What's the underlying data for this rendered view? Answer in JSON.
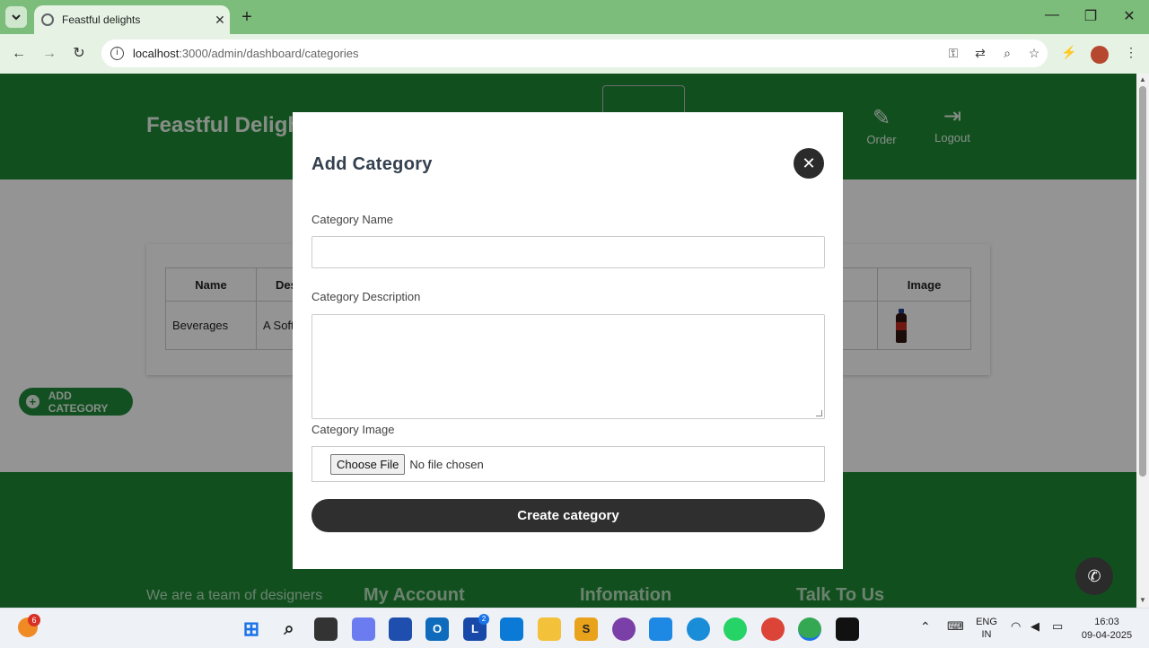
{
  "browser": {
    "tab_title": "Feastful delights",
    "tab_close": "✕",
    "new_tab": "+",
    "url_host": "localhost",
    "url_rest": ":3000/admin/dashboard/categories",
    "window_controls": [
      "—",
      "❐",
      "✕"
    ]
  },
  "site": {
    "brand": "Feastful Delight",
    "nav": [
      {
        "label": "Order",
        "icon": "pen-icon"
      },
      {
        "label": "Logout",
        "icon": "logout-icon"
      }
    ]
  },
  "table": {
    "headers": [
      "Name",
      "Des",
      "Image"
    ],
    "rows": [
      {
        "name": "Beverages",
        "description": "A Soft",
        "image": "bottle-image"
      }
    ]
  },
  "add_category_button": "ADD CATEGORY",
  "footer": {
    "about": "We are a team of designers",
    "columns": [
      "My Account",
      "Infomation",
      "Talk To Us"
    ]
  },
  "modal": {
    "title": "Add Category",
    "close": "✕",
    "name_label": "Category Name",
    "description_label": "Category Description",
    "image_label": "Category Image",
    "file_button": "Choose File",
    "file_status": "No file chosen",
    "submit": "Create category"
  },
  "taskbar": {
    "notification_count": "6",
    "badge_l": "2",
    "lang_line1": "ENG",
    "lang_line2": "IN",
    "time": "16:03",
    "date": "09-04-2025"
  },
  "colors": {
    "header_green": "#1e8a34",
    "browser_frame": "#7dbd7b",
    "button_dark": "#2f2f2f"
  }
}
